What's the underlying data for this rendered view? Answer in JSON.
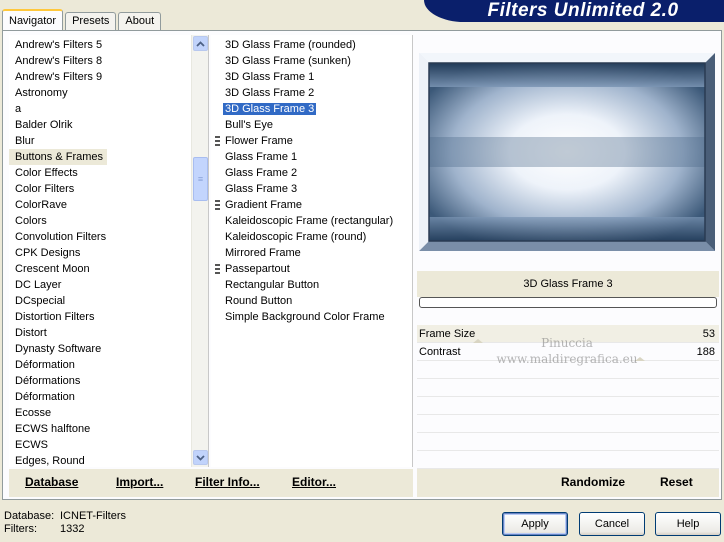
{
  "tabs": [
    {
      "label": "Navigator",
      "active": true
    },
    {
      "label": "Presets",
      "active": false
    },
    {
      "label": "About",
      "active": false
    }
  ],
  "banner": {
    "title": "Filters Unlimited 2.0",
    "color": "#0a1f6b"
  },
  "categories": {
    "items": [
      "Andrew's Filters 5",
      "Andrew's Filters 8",
      "Andrew's Filters 9",
      "Astronomy",
      "a",
      "Balder Olrik",
      "Blur",
      "Buttons & Frames",
      "Color Effects",
      "Color Filters",
      "ColorRave",
      "Colors",
      "Convolution Filters",
      "CPK Designs",
      "Crescent Moon",
      "DC Layer",
      "DCspecial",
      "Distortion Filters",
      "Distort",
      "Dynasty Software",
      "Déformation",
      "Déformations",
      "Déformation",
      "Ecosse",
      "ECWS halftone",
      "ECWS",
      "Edges, Round"
    ],
    "selected": "Buttons & Frames"
  },
  "filters": {
    "items": [
      {
        "label": "3D Glass Frame (rounded)",
        "marked": false
      },
      {
        "label": "3D Glass Frame (sunken)",
        "marked": false
      },
      {
        "label": "3D Glass Frame 1",
        "marked": false
      },
      {
        "label": "3D Glass Frame 2",
        "marked": false
      },
      {
        "label": "3D Glass Frame 3",
        "marked": false
      },
      {
        "label": "Bull's Eye",
        "marked": false
      },
      {
        "label": "Flower Frame",
        "marked": true
      },
      {
        "label": "Glass Frame 1",
        "marked": false
      },
      {
        "label": "Glass Frame 2",
        "marked": false
      },
      {
        "label": "Glass Frame 3",
        "marked": false
      },
      {
        "label": "Gradient Frame",
        "marked": true
      },
      {
        "label": "Kaleidoscopic Frame (rectangular)",
        "marked": false
      },
      {
        "label": "Kaleidoscopic Frame (round)",
        "marked": false
      },
      {
        "label": "Mirrored Frame",
        "marked": false
      },
      {
        "label": "Passepartout",
        "marked": true
      },
      {
        "label": "Rectangular Button",
        "marked": false
      },
      {
        "label": "Round Button",
        "marked": false
      },
      {
        "label": "Simple Background Color Frame",
        "marked": false
      }
    ],
    "selected": "3D Glass Frame 3"
  },
  "left_buttons": {
    "database": "Database",
    "import": "Import...",
    "filter_info": "Filter Info...",
    "editor": "Editor..."
  },
  "preview": {
    "label": "3D Glass Frame 3"
  },
  "params": [
    {
      "label": "Frame Size",
      "value": "53"
    },
    {
      "label": "Contrast",
      "value": "188"
    }
  ],
  "watermark": {
    "line1": "Pinuccia",
    "line2": "www.maldiregrafica.eu"
  },
  "right_buttons": {
    "randomize": "Randomize",
    "reset": "Reset"
  },
  "status": {
    "database_label": "Database:",
    "database_value": "ICNET-Filters",
    "filters_label": "Filters:",
    "filters_value": "1332"
  },
  "dialog": {
    "apply": "Apply",
    "cancel": "Cancel",
    "help": "Help"
  },
  "colors": {
    "selection": "#316ac5",
    "window_bg": "#ece9d8"
  }
}
